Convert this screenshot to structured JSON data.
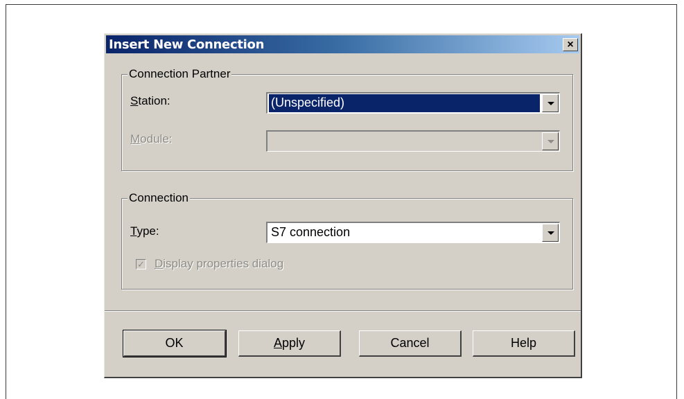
{
  "dialog": {
    "title": "Insert New Connection",
    "close_glyph": "×"
  },
  "partner_group": {
    "legend": "Connection Partner",
    "station": {
      "label_mnemonic": "S",
      "label_rest": "tation:",
      "value": "(Unspecified)"
    },
    "module": {
      "label_mnemonic": "M",
      "label_rest": "odule:",
      "value": ""
    }
  },
  "connection_group": {
    "legend": "Connection",
    "type": {
      "label_mnemonic": "T",
      "label_rest": "ype:",
      "value": "S7 connection"
    },
    "display_properties": {
      "checked": true,
      "check_glyph": "✓",
      "label_mnemonic": "D",
      "label_rest": "isplay properties dialog"
    }
  },
  "buttons": {
    "ok": "OK",
    "apply_mnemonic": "A",
    "apply_rest": "pply",
    "cancel": "Cancel",
    "help": "Help"
  },
  "icons": [
    "close-icon",
    "dropdown-arrow-icon",
    "checkmark-icon"
  ]
}
